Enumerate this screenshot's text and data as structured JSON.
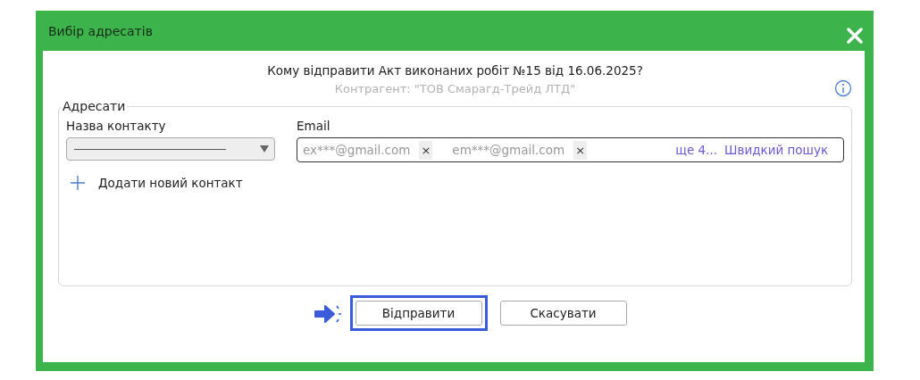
{
  "window": {
    "title": "Вибір адресатів"
  },
  "header": {
    "question": "Кому відправити Акт виконаних робіт №15 від 16.06.2025?",
    "counterparty": "Контрагент: \"ТОВ Смарагд-Трейд ЛТД\""
  },
  "recipients": {
    "legend": "Адресати",
    "contact_label": "Назва контакту",
    "email_label": "Email",
    "emails": [
      {
        "address": "ex***@gmail.com",
        "remove": "×"
      },
      {
        "address": "em***@gmail.com",
        "remove": "×"
      }
    ],
    "more": "ще 4...",
    "search_placeholder": "Швидкий пошук",
    "add_contact": "Додати новий контакт"
  },
  "buttons": [
    {
      "label": "Відправити",
      "highlighted": true
    },
    {
      "label": "Скасувати",
      "highlighted": false
    }
  ]
}
